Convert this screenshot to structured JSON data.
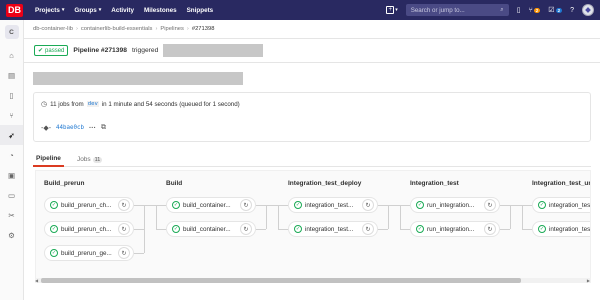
{
  "navbar": {
    "logo": "DB",
    "links": [
      {
        "label": "Projects",
        "dropdown": true
      },
      {
        "label": "Groups",
        "dropdown": true
      },
      {
        "label": "Activity",
        "dropdown": false
      },
      {
        "label": "Milestones",
        "dropdown": false
      },
      {
        "label": "Snippets",
        "dropdown": false
      }
    ],
    "plus": "+",
    "search_placeholder": "Search or jump to...",
    "merge_requests_count": "2",
    "todos_count": "2"
  },
  "sidebar": {
    "project_letter": "C",
    "icons": [
      "home-icon",
      "repository-icon",
      "issues-icon",
      "merge-request-icon",
      "rocket-icon",
      "operations-icon",
      "package-icon",
      "wiki-icon",
      "snippets-icon",
      "settings-icon"
    ]
  },
  "breadcrumb": {
    "items": [
      "db-container-lib",
      "containerlib-build-essentials",
      "Pipelines",
      "#271398"
    ]
  },
  "header": {
    "status": "passed",
    "title": "Pipeline #271398",
    "triggered": "triggered"
  },
  "info": {
    "jobs_prefix": "11 jobs from",
    "branch": "dev",
    "jobs_suffix": "in 1 minute and 54 seconds (queued for 1 second)",
    "sha": "44bae0cb"
  },
  "tabs": [
    {
      "label": "Pipeline",
      "count": ""
    },
    {
      "label": "Jobs",
      "count": "11"
    }
  ],
  "stages": [
    {
      "name": "Build_prerun",
      "jobs": [
        "build_prerun_ch...",
        "build_prerun_ch...",
        "build_prerun_ge..."
      ]
    },
    {
      "name": "Build",
      "jobs": [
        "build_container...",
        "build_container..."
      ]
    },
    {
      "name": "Integration_test_deploy",
      "jobs": [
        "integration_test...",
        "integration_test..."
      ]
    },
    {
      "name": "Integration_test",
      "jobs": [
        "run_integration...",
        "run_integration..."
      ]
    },
    {
      "name": "Integration_test_und",
      "jobs": [
        "integration_test...",
        "integration_test..."
      ]
    }
  ],
  "colors": {
    "navbar": "#292961",
    "brand": "#ec0016",
    "success": "#1aaa55",
    "link": "#1f78d1",
    "active_tab": "#db3b21"
  }
}
